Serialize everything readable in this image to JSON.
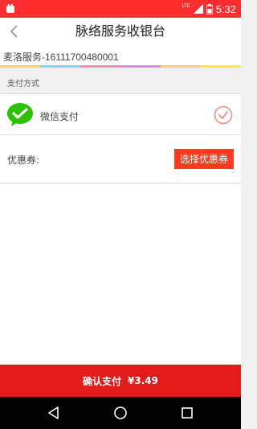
{
  "status_bar": {
    "network": "LTE",
    "time": "5:32",
    "bg": "#ff2d2d"
  },
  "header": {
    "title": "脉络服务收银台",
    "back_icon": "chevron-left-icon"
  },
  "order": {
    "text": "麦洛服务-16111700480001",
    "rainbow": [
      "#ffd54f",
      "#81d4fa",
      "#f48fb1",
      "#ce93d8",
      "#ffcc80",
      "#ffeb3b"
    ]
  },
  "payment": {
    "section_label": "支付方式",
    "method_label": "微信支付",
    "method_icon": "wechat-icon",
    "selected_icon": "check-circle-icon",
    "accent": "#f28b82"
  },
  "coupon": {
    "label": "优惠券:",
    "button_label": "选择优惠券",
    "button_color": "#ff3b1f"
  },
  "confirm": {
    "label": "确认支付",
    "amount": "¥3.49",
    "bg": "#e31b1b"
  },
  "nav": {
    "icons": [
      "back-triangle-icon",
      "home-circle-icon",
      "recents-square-icon"
    ]
  }
}
